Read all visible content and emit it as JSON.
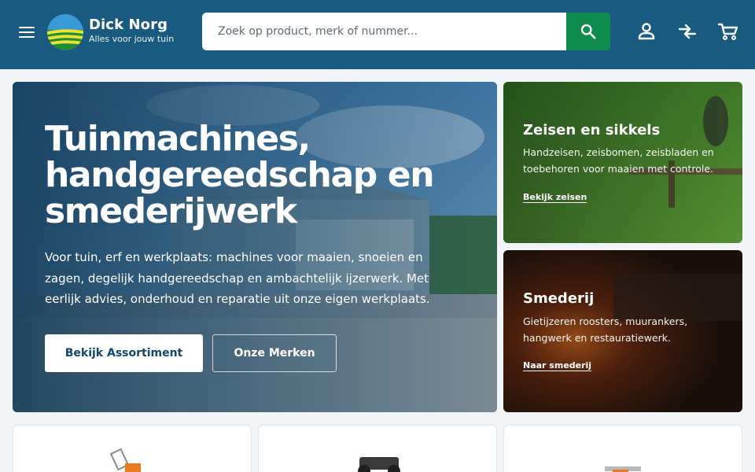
{
  "header": {
    "brand_name": "Dick Norg",
    "brand_tagline": "Alles voor jouw tuin",
    "search_placeholder": "Zoek op product, merk of nummer...",
    "colors": {
      "header_bg": "#1a5a7e",
      "search_button": "#0d8a4e"
    },
    "icons": [
      "menu-icon",
      "search-icon",
      "account-icon",
      "compare-icon",
      "cart-icon"
    ]
  },
  "hero": {
    "title": "Tuinmachines, handgereedschap en smederijwerk",
    "text": "Voor tuin, erf en werkplaats: machines voor maaien, snoeien en zagen, degelijk handgereedschap en ambachtelijk ijzerwerk. Met eerlijk advies, onderhoud en reparatie uit onze eigen werkplaats.",
    "primary_button": "Bekijk Assortiment",
    "secondary_button": "Onze Merken"
  },
  "cards": [
    {
      "title": "Zeisen en sikkels",
      "text": "Handzeisen, zeisbomen, zeisbladen en toebehoren voor maaien met controle.",
      "link": "Bekijk zeisen"
    },
    {
      "title": "Smederij",
      "text": "Gietijzeren roosters, muurankers, hangwerk en restauratiewerk.",
      "link": "Naar smederij"
    }
  ]
}
